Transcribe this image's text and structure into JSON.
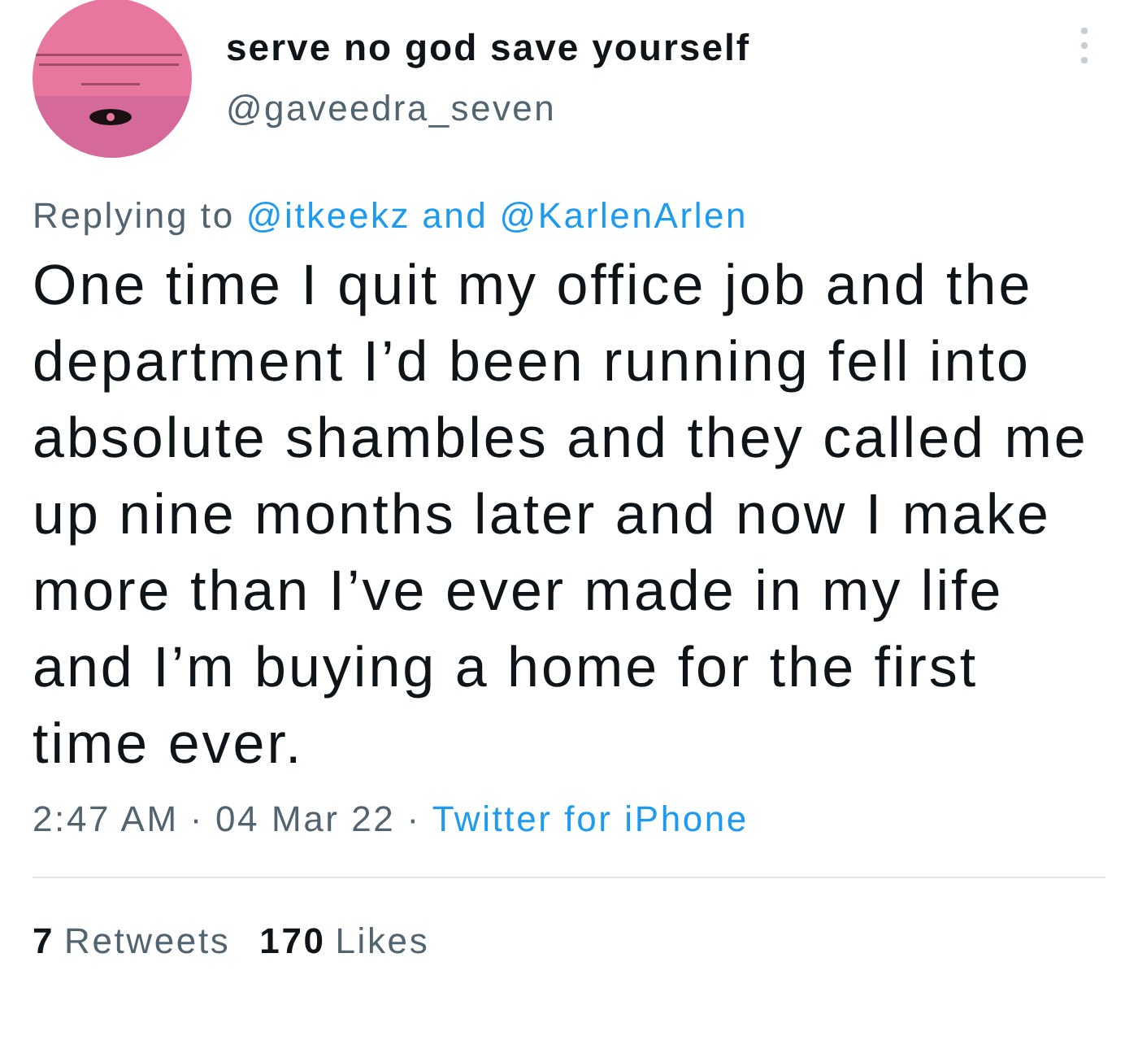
{
  "author": {
    "name": "serve no god save yourself",
    "handle": "@gaveedra_seven"
  },
  "replying": {
    "prefix": "Replying to",
    "mentions": [
      "@itkeekz",
      "@KarlenArlen"
    ],
    "joiner": "and"
  },
  "body": "One time I quit my office job and the department I’d been running fell into absolute shambles and they called me up nine months later and now I make more than I’ve ever made in my life and I’m buying a home for the first time ever.",
  "meta": {
    "time": "2:47 AM",
    "separator": "·",
    "date": "04 Mar 22",
    "source": "Twitter for iPhone"
  },
  "stats": [
    {
      "count": "7",
      "label": "Retweets"
    },
    {
      "count": "170",
      "label": "Likes"
    }
  ]
}
